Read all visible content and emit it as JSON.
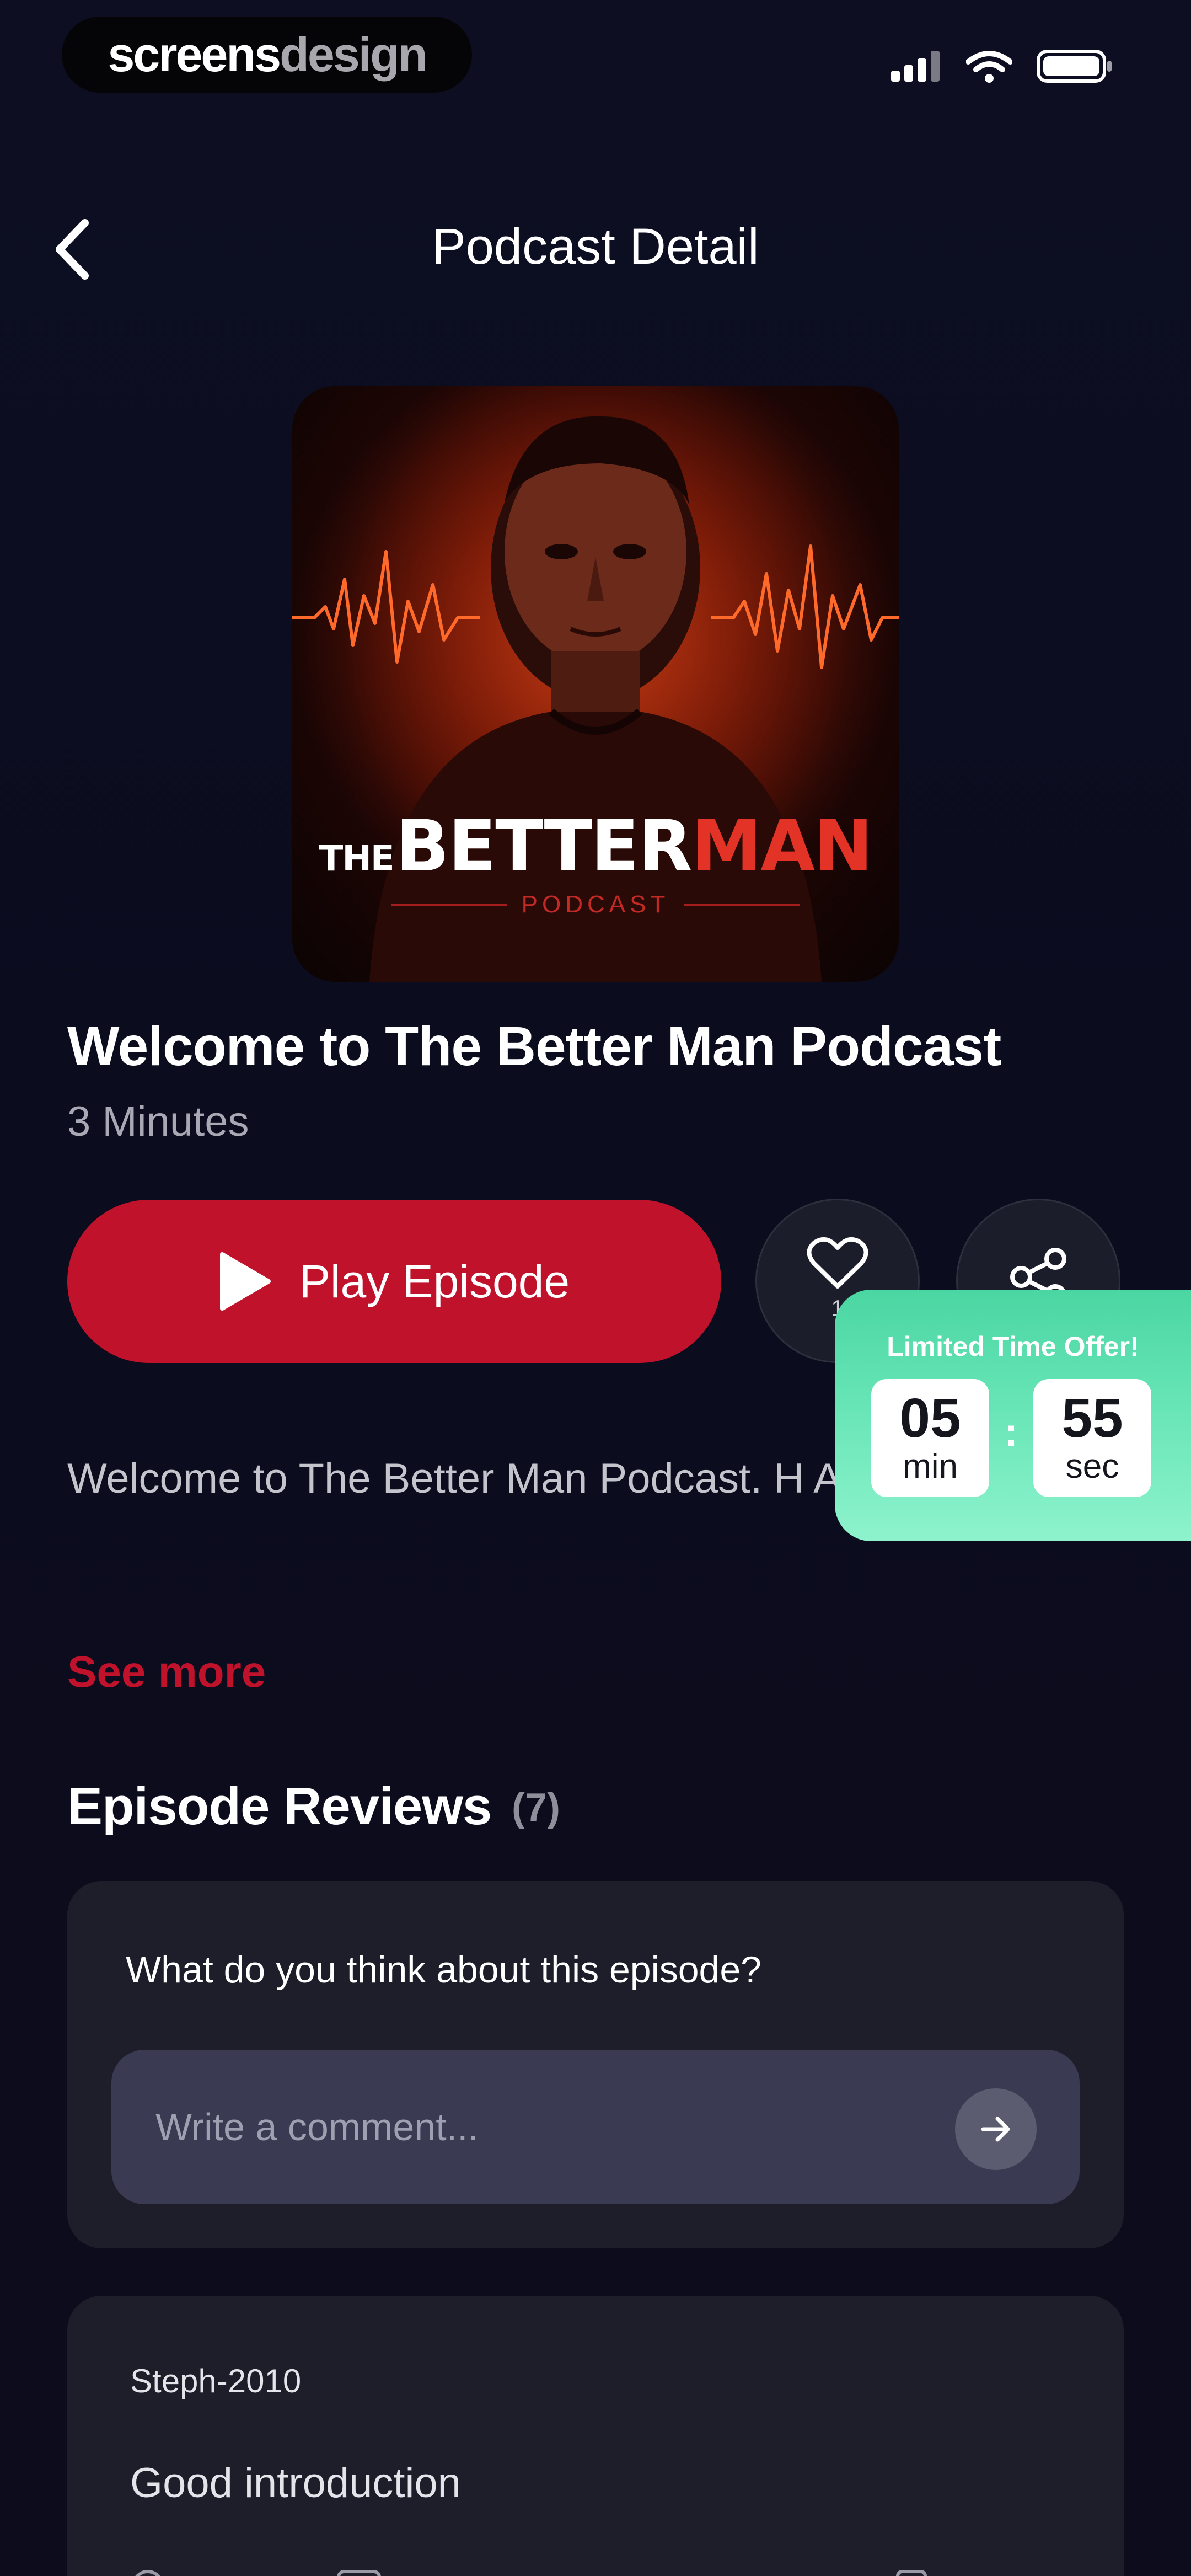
{
  "watermark": {
    "part1": "screens",
    "part2": "design"
  },
  "header": {
    "title": "Podcast Detail"
  },
  "cover": {
    "the": "THE",
    "better": "BETTER",
    "man": "MAN",
    "podcast": "PODCAST"
  },
  "episode": {
    "title": "Welcome to The Better Man Podcast",
    "duration": "3 Minutes",
    "play_label": "Play Episode",
    "like_count": "1",
    "description": "Welcome to The Better Man Podcast. H Alex, this seri...",
    "see_more": "See more"
  },
  "offer": {
    "title": "Limited Time Offer!",
    "minutes": "05",
    "minutes_unit": "min",
    "colon": ":",
    "seconds": "55",
    "seconds_unit": "sec"
  },
  "reviews": {
    "title": "Episode Reviews",
    "count": "(7)",
    "prompt": "What do you think about this episode?",
    "input_placeholder": "Write a comment...",
    "items": [
      {
        "user": "Steph-2010",
        "text": "Good introduction"
      }
    ]
  },
  "colors": {
    "accent": "#c1122c",
    "offer": "#6ae6b8",
    "background": "#0c0d1f",
    "card": "#1e1e2b"
  },
  "icons": [
    "back-chevron-icon",
    "signal-icon",
    "wifi-icon",
    "battery-icon",
    "play-icon",
    "heart-icon",
    "share-icon",
    "arrow-right-icon"
  ]
}
